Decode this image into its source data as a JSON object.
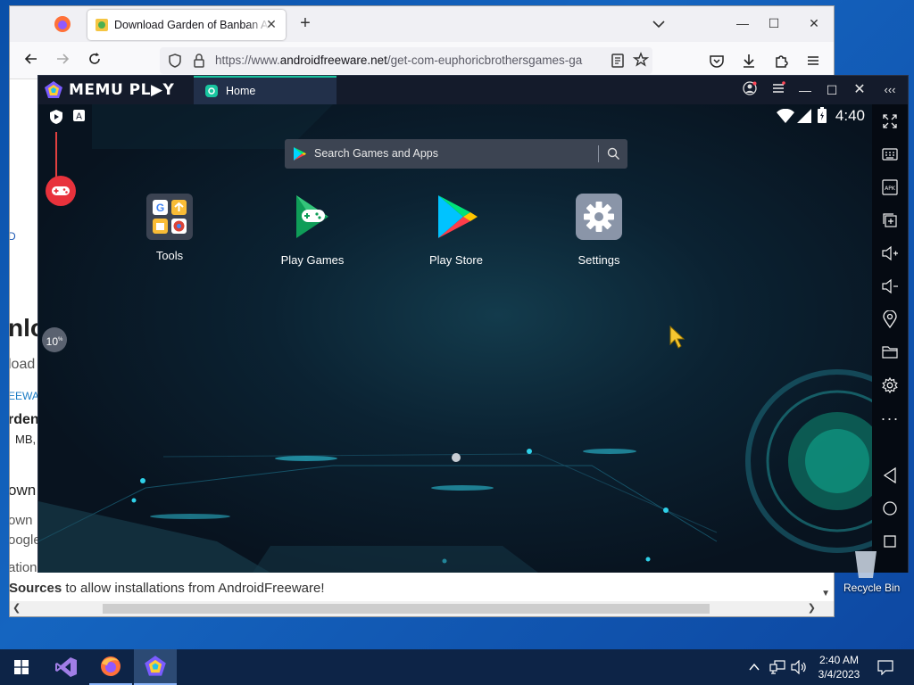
{
  "browser": {
    "tab_title": "Download Garden of Banban APK for Android",
    "url_prefix": "https://www.",
    "url_domain": "androidfreeware.net",
    "url_path": "/get-com-euphoricbrothersgames-ga",
    "page_fragments": {
      "heading1": "nlo",
      "text1": "load",
      "link1": "EEWAR",
      "heading2": "rden",
      "text2": "MB,",
      "heading3": "own",
      "text3": "own",
      "text4": "oogle",
      "text5": "ation",
      "bold": "Sources",
      "sentence": " to allow installations from AndroidFreeware!",
      "left_letter_m": "M",
      "left_letter_d": "D"
    }
  },
  "memu": {
    "logo": "MEMU PL▶Y",
    "tab_home": "Home",
    "time": "4:40",
    "search_placeholder": "Search Games and Apps",
    "apps": [
      {
        "label": "Tools"
      },
      {
        "label": "Play Games"
      },
      {
        "label": "Play Store"
      },
      {
        "label": "Settings"
      }
    ],
    "float_badge": "10",
    "float_badge_sup": "%"
  },
  "desktop": {
    "recycle_bin": "Recycle Bin",
    "clock_time": "2:40 AM",
    "clock_date": "3/4/2023"
  },
  "colors": {
    "memu_accent": "#18c6a0",
    "taskbar": "#0d2447",
    "desktop": "#1565c0"
  }
}
